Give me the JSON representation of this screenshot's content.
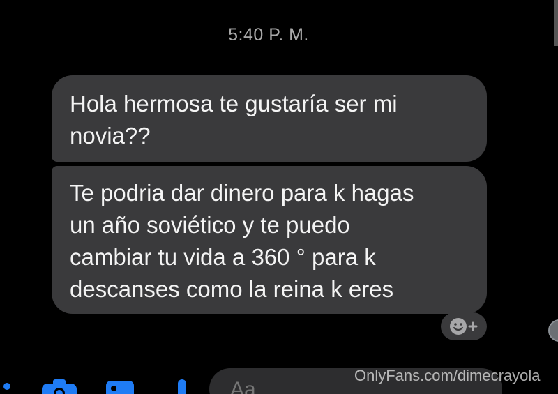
{
  "conversation": {
    "timestamp": "5:40 P. M.",
    "messages": [
      {
        "lines": [
          "Hola hermosa te gustaría ser mi",
          "novia??"
        ]
      },
      {
        "lines": [
          "Te podria dar dinero para k hagas",
          "un año soviético y te puedo",
          "cambiar tu vida a 360 ° para k",
          "descanses como la reina k eres"
        ]
      }
    ]
  },
  "reaction_button": {
    "icon": "smiley-add-icon"
  },
  "composer": {
    "placeholder": "Aa",
    "icons": [
      "menu-dots-icon",
      "camera-icon",
      "gallery-icon",
      "microphone-icon"
    ]
  },
  "watermark": {
    "text": "OnlyFans.com/dimecrayola"
  },
  "colors": {
    "background": "#000000",
    "bubble": "#3a3a3c",
    "text": "#f4f4f4",
    "timestamp": "#a9a9a9",
    "accent": "#1f7cf5"
  }
}
